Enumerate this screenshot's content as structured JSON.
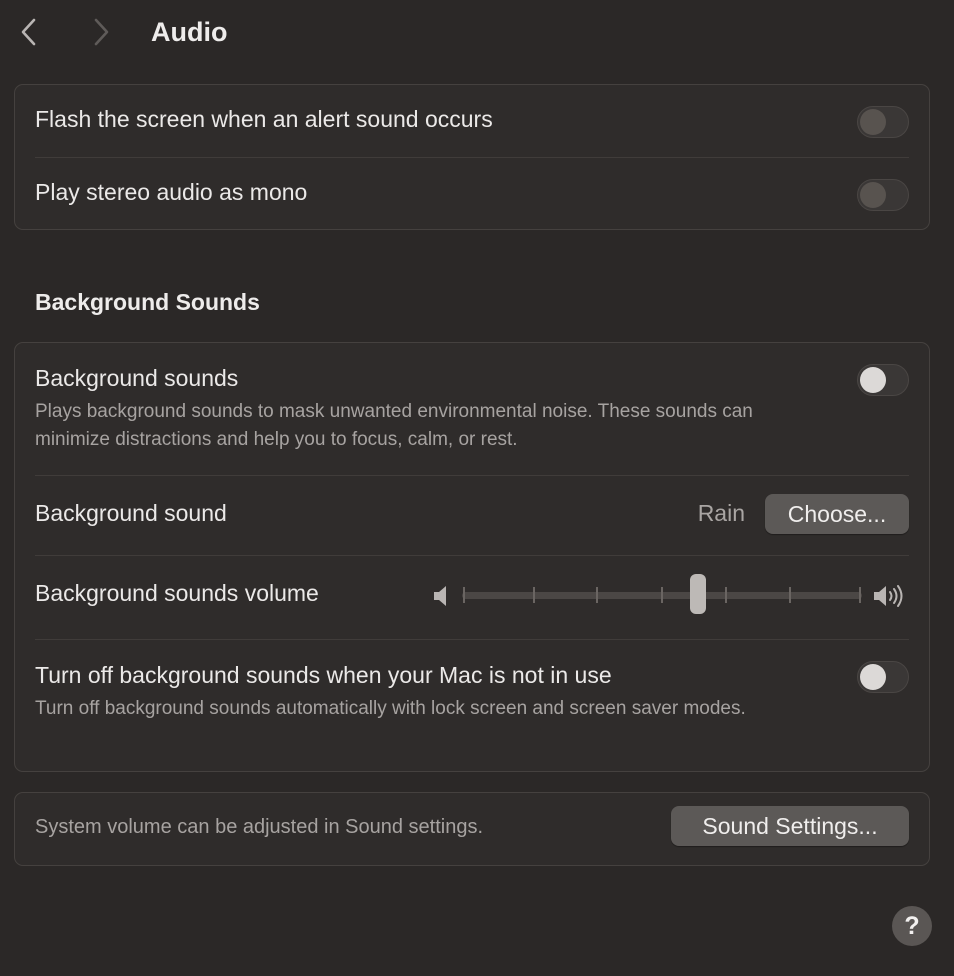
{
  "header": {
    "title": "Audio"
  },
  "alerts": {
    "flash_label": "Flash the screen when an alert sound occurs",
    "flash_on": false,
    "mono_label": "Play stereo audio as mono",
    "mono_on": false
  },
  "background_sounds": {
    "heading": "Background Sounds",
    "toggle_label": "Background sounds",
    "toggle_on": false,
    "toggle_desc": "Plays background sounds to mask unwanted environmental noise. These sounds can minimize distractions and help you to focus, calm, or rest.",
    "sound_label": "Background sound",
    "sound_value": "Rain",
    "choose_button": "Choose...",
    "volume_label": "Background sounds volume",
    "volume_level": 0.59,
    "turn_off_label": "Turn off background sounds when your Mac is not in use",
    "turn_off_on": false,
    "turn_off_desc": "Turn off background sounds automatically with lock screen and screen saver modes."
  },
  "footer_group": {
    "note": "System volume can be adjusted in Sound settings.",
    "sound_settings_button": "Sound Settings..."
  },
  "help_button": "?",
  "icons": {
    "back": "chevron-left-icon",
    "forward": "chevron-right-icon",
    "volume_low": "speaker-low-icon",
    "volume_high": "speaker-high-icon"
  }
}
